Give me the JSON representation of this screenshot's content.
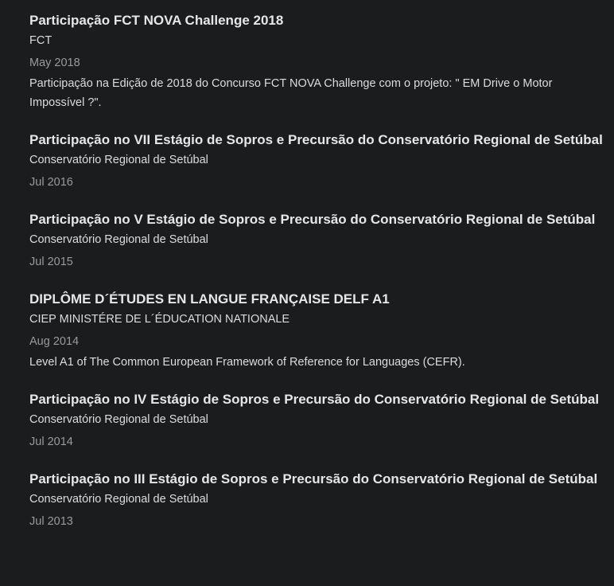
{
  "entries": [
    {
      "title": "Participação FCT NOVA Challenge 2018",
      "org": "FCT",
      "date": "May 2018",
      "desc": "Participação na Edição de 2018 do Concurso FCT NOVA Challenge com o projeto: \" EM Drive o Motor Impossível ?\"."
    },
    {
      "title": "Participação no VII Estágio de Sopros e Precursão do Conservatório Regional de Setúbal",
      "org": "Conservatório Regional de Setúbal",
      "date": "Jul 2016",
      "desc": ""
    },
    {
      "title": "Participação no V Estágio de Sopros e Precursão do Conservatório Regional de Setúbal",
      "org": "Conservatório Regional de Setúbal",
      "date": "Jul 2015",
      "desc": ""
    },
    {
      "title": "DIPLÔME D´ÉTUDES EN LANGUE FRANÇAISE DELF A1",
      "org": "CIEP MINISTÉRE DE L´ÉDUCATION NATIONALE",
      "date": "Aug 2014",
      "desc": "Level A1 of The Common European Framework of Reference for Languages (CEFR)."
    },
    {
      "title": "Participação no IV Estágio de Sopros e Precursão do Conservatório Regional de Setúbal",
      "org": "Conservatório Regional de Setúbal",
      "date": "Jul 2014",
      "desc": ""
    },
    {
      "title": "Participação no III Estágio de Sopros e Precursão do Conservatório Regional de Setúbal",
      "org": "Conservatório Regional de Setúbal",
      "date": "Jul 2013",
      "desc": ""
    }
  ]
}
